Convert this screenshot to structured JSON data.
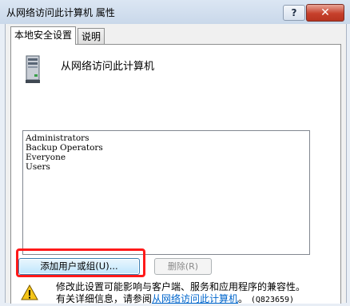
{
  "window": {
    "title": "从网络访问此计算机 属性",
    "help_label": "?",
    "close_label": "✕"
  },
  "tabs": [
    {
      "label": "本地安全设置",
      "active": true
    },
    {
      "label": "说明",
      "active": false
    }
  ],
  "policy": {
    "icon": "computer-tower-icon",
    "title": "从网络访问此计算机"
  },
  "accounts": [
    "Administrators",
    "Backup Operators",
    "Everyone",
    "Users"
  ],
  "buttons": {
    "add": "添加用户或组(U)...",
    "remove": "删除(R)"
  },
  "warning": {
    "icon": "warning-icon",
    "line1": "修改此设置可能影响与客户端、服务和应用程序的兼容性。",
    "line2_prefix": "有关详细信息，请参阅",
    "link": "从网络访问此计算机",
    "line2_suffix": "。",
    "kb": "(Q823659)"
  },
  "colors": {
    "highlight": "#ff1a1a",
    "link": "#0066cc",
    "close": "#c6402c"
  }
}
